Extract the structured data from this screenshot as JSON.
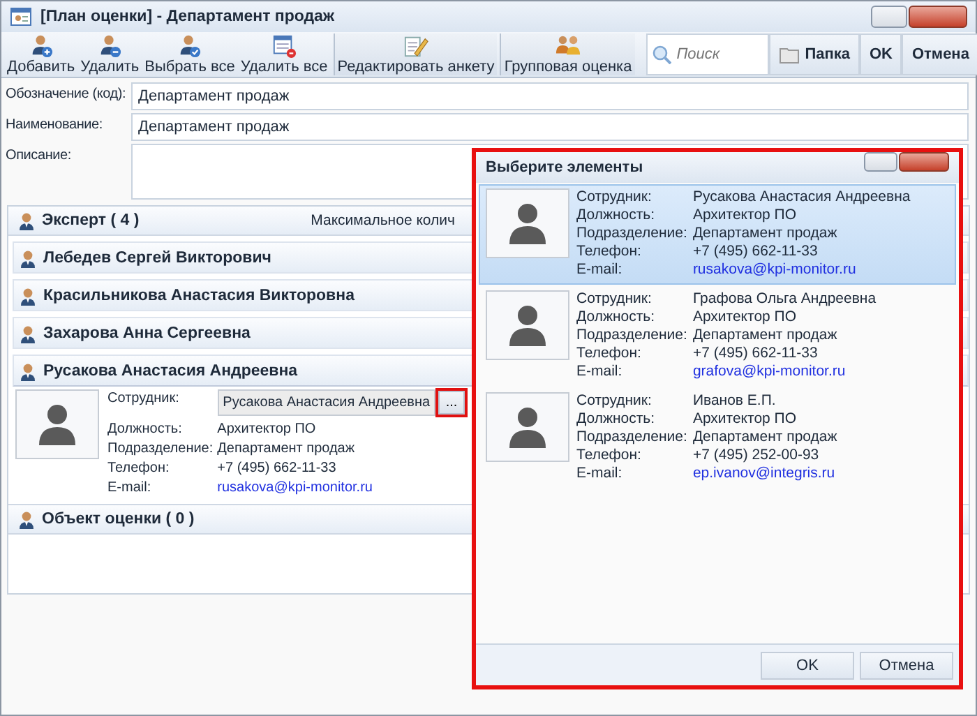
{
  "window": {
    "title": "[План оценки] - Департамент продаж"
  },
  "toolbar": {
    "buttons": [
      {
        "label": "Добавить",
        "kind": "add"
      },
      {
        "label": "Удалить",
        "kind": "remove"
      },
      {
        "label": "Выбрать все",
        "kind": "check"
      },
      {
        "label": "Удалить все",
        "kind": "clear"
      },
      {
        "label": "Редактировать анкету",
        "kind": "edit"
      },
      {
        "label": "Групповая оценка",
        "kind": "group"
      }
    ],
    "search": {
      "placeholder": "Поиск"
    },
    "folder_button": "Папка",
    "ok_button": "OK",
    "cancel_button": "Отмена"
  },
  "form": {
    "fields": [
      {
        "label": "Обозначение (код):",
        "value": "Департамент продаж",
        "kind": "line"
      },
      {
        "label": "Наименование:",
        "value": "Департамент продаж",
        "kind": "line"
      },
      {
        "label": "Описание:",
        "kind": "area"
      }
    ]
  },
  "experts": {
    "title": "Эксперт ( 4 )",
    "note": "Максимальное колич",
    "members": [
      {
        "name": "Лебедев Сергей Викторович",
        "expanded": false
      },
      {
        "name": "Красильникова Анастасия Викторовна",
        "expanded": false
      },
      {
        "name": "Захарова Анна Сергеевна",
        "expanded": false
      },
      {
        "name": "Русакова Анастасия Андреевна",
        "expanded": true,
        "details": [
          {
            "label": "Сотрудник:",
            "value": "Русакова Анастасия Андреевна",
            "kind": "picker",
            "button": "...",
            "highlighted": true
          },
          {
            "label": "Должность:",
            "value": "Архитектор ПО",
            "kind": "text"
          },
          {
            "label": "Подразделение:",
            "value": "Департамент продаж",
            "kind": "text"
          },
          {
            "label": "Телефон:",
            "value": "+7 (495) 662-11-33",
            "kind": "text"
          },
          {
            "label": "E-mail:",
            "value": "rusakova@kpi-monitor.ru",
            "kind": "email"
          }
        ]
      }
    ]
  },
  "objects": {
    "title": "Объект оценки ( 0 )"
  },
  "dialog": {
    "title": "Выберите элементы",
    "highlighted": true,
    "items": [
      {
        "selected": true,
        "fields": [
          {
            "label": "Сотрудник:",
            "value": "Русакова Анастасия Андреевна",
            "kind": "text"
          },
          {
            "label": "Должность:",
            "value": "Архитектор ПО",
            "kind": "text"
          },
          {
            "label": "Подразделение:",
            "value": "Департамент продаж",
            "kind": "text"
          },
          {
            "label": "Телефон:",
            "value": "+7 (495) 662-11-33",
            "kind": "text"
          },
          {
            "label": "E-mail:",
            "value": "rusakova@kpi-monitor.ru",
            "kind": "email"
          }
        ]
      },
      {
        "selected": false,
        "fields": [
          {
            "label": "Сотрудник:",
            "value": "Графова Ольга Андреевна",
            "kind": "text"
          },
          {
            "label": "Должность:",
            "value": "Архитектор ПО",
            "kind": "text"
          },
          {
            "label": "Подразделение:",
            "value": "Департамент продаж",
            "kind": "text"
          },
          {
            "label": "Телефон:",
            "value": "+7 (495) 662-11-33",
            "kind": "text"
          },
          {
            "label": "E-mail:",
            "value": "grafova@kpi-monitor.ru",
            "kind": "email"
          }
        ]
      },
      {
        "selected": false,
        "fields": [
          {
            "label": "Сотрудник:",
            "value": "Иванов Е.П.",
            "kind": "text"
          },
          {
            "label": "Должность:",
            "value": "Архитектор ПО",
            "kind": "text"
          },
          {
            "label": "Подразделение:",
            "value": "Департамент продаж",
            "kind": "text"
          },
          {
            "label": "Телефон:",
            "value": "+7 (495) 252-00-93",
            "kind": "text"
          },
          {
            "label": "E-mail:",
            "value": "ep.ivanov@integris.ru",
            "kind": "email"
          }
        ]
      }
    ],
    "buttons": [
      "OK",
      "Отмена"
    ]
  }
}
